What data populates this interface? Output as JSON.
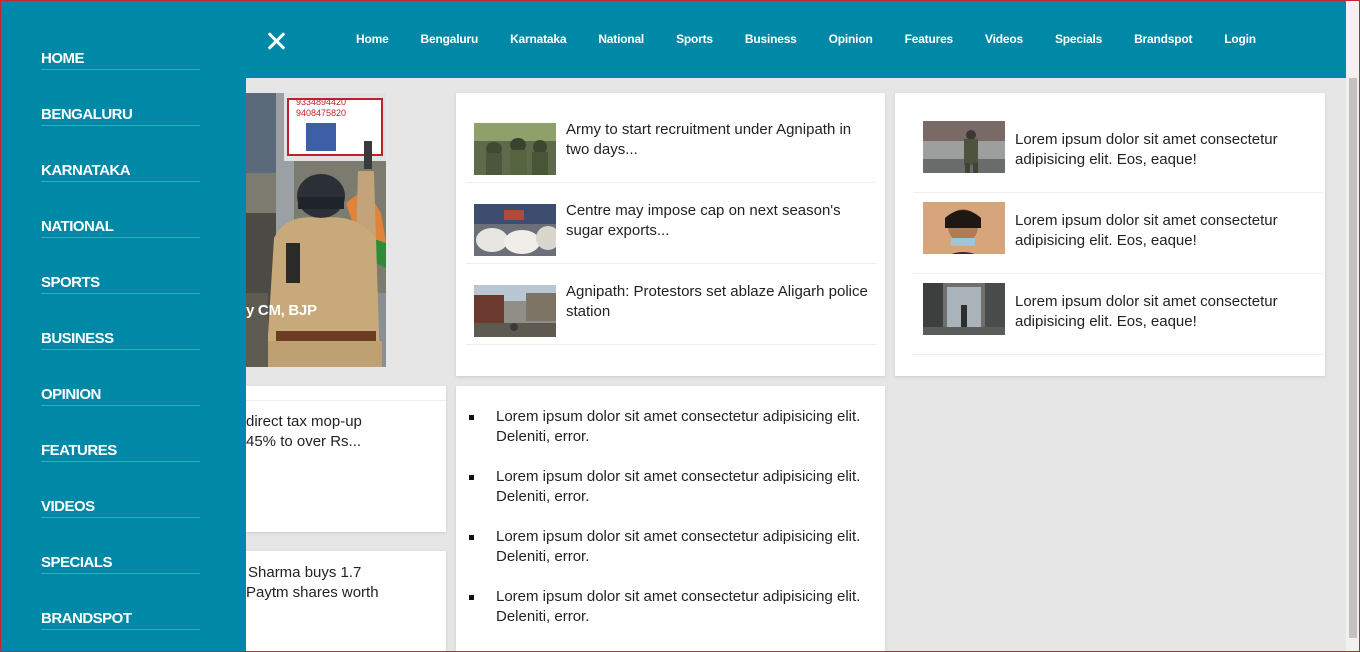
{
  "topnav": [
    "Home",
    "Bengaluru",
    "Karnataka",
    "National",
    "Sports",
    "Business",
    "Opinion",
    "Features",
    "Videos",
    "Specials",
    "Brandspot",
    "Login"
  ],
  "drawer": [
    "HOME",
    "BENGALURU",
    "KARNATAKA",
    "NATIONAL",
    "SPORTS",
    "BUSINESS",
    "OPINION",
    "FEATURES",
    "VIDEOS",
    "SPECIALS",
    "BRANDSPOT"
  ],
  "hero": {
    "caption": "y CM, BJP",
    "sign_line1": "9334894420",
    "sign_line2": "9408475820"
  },
  "news_middle": [
    {
      "title": "Army to start recruitment under Agnipath in two days...",
      "image": "soldiers-photo"
    },
    {
      "title": "Centre may impose cap on next season's sugar exports...",
      "image": "sugar-bags-photo"
    },
    {
      "title": "Agnipath: Protestors set ablaze Aligarh police station",
      "image": "burnt-street-photo"
    }
  ],
  "news_right": [
    {
      "title": "Lorem ipsum dolor sit amet consectetur adipisicing elit. Eos, eaque!",
      "image": "soldier-street-photo"
    },
    {
      "title": "Lorem ipsum dolor sit amet consectetur adipisicing elit. Eos, eaque!",
      "image": "woman-portrait-photo"
    },
    {
      "title": "Lorem ipsum dolor sit amet consectetur adipisicing elit. Eos, eaque!",
      "image": "corridor-photo"
    }
  ],
  "list_items": [
    "Lorem ipsum dolor sit amet consectetur adipisicing elit. Deleniti, error.",
    "Lorem ipsum dolor sit amet consectetur adipisicing elit. Deleniti, error.",
    "Lorem ipsum dolor sit amet consectetur adipisicing elit. Deleniti, error.",
    "Lorem ipsum dolor sit amet consectetur adipisicing elit. Deleniti, error."
  ],
  "partial_left": {
    "story1_line1": "direct tax mop-up",
    "story1_line2": "45% to over Rs...",
    "story2_line1": "Sharma buys 1.7",
    "story2_line2": "Paytm shares worth"
  },
  "colors": {
    "brand": "#0088a7",
    "background": "#e6e6e6",
    "border": "#c0282d"
  }
}
